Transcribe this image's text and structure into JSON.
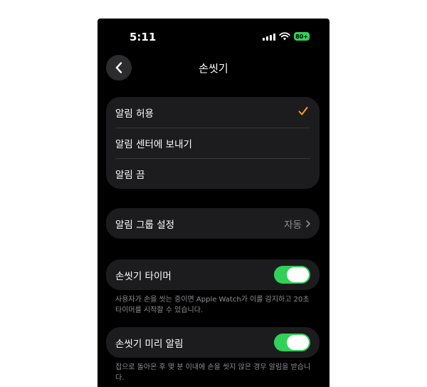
{
  "status_bar": {
    "time": "5:11",
    "battery": "80+"
  },
  "nav": {
    "title": "손씻기"
  },
  "alert_options": [
    {
      "label": "알림 허용",
      "selected": true
    },
    {
      "label": "알림 센터에 보내기",
      "selected": false
    },
    {
      "label": "알림 끔",
      "selected": false
    }
  ],
  "grouping": {
    "label": "알림 그룹 설정",
    "value": "자동"
  },
  "timer": {
    "label": "손씻기 타이머",
    "enabled": true,
    "footnote": "사용자가 손을 씻는 중이면 Apple Watch가 이를 감지하고 20초 타이머를 시작할 수 있습니다."
  },
  "reminder": {
    "label": "손씻기 미리 알림",
    "enabled": true,
    "footnote": "집으로 돌아온 후 몇 분 이내에 손을 씻지 않은 경우 알림을 받습니다."
  },
  "colors": {
    "accent_check": "#ff9f0a",
    "toggle_on": "#30d158",
    "background": "#000000",
    "cell": "#1c1c1e"
  }
}
